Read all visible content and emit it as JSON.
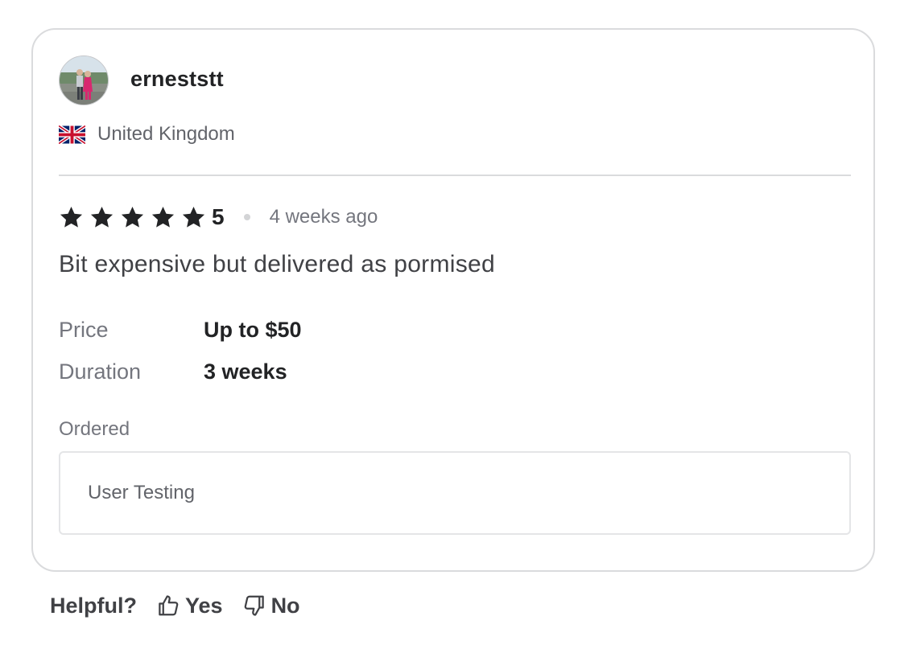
{
  "review": {
    "user": {
      "name": "erneststt",
      "avatar_icon": "user-avatar-photo",
      "country": "United Kingdom",
      "flag_icon": "uk-flag-icon"
    },
    "rating": {
      "stars": 5,
      "max_stars": 5,
      "value_label": "5",
      "star_color": "#222325"
    },
    "time_ago": "4 weeks ago",
    "text": "Bit expensive but delivered as pormised",
    "details": [
      {
        "label": "Price",
        "value": "Up to $50"
      },
      {
        "label": "Duration",
        "value": "3 weeks"
      }
    ],
    "ordered": {
      "label": "Ordered",
      "value": "User Testing"
    }
  },
  "helpful": {
    "label": "Helpful?",
    "yes_label": "Yes",
    "no_label": "No",
    "yes_icon": "thumbs-up-icon",
    "no_icon": "thumbs-down-icon"
  }
}
